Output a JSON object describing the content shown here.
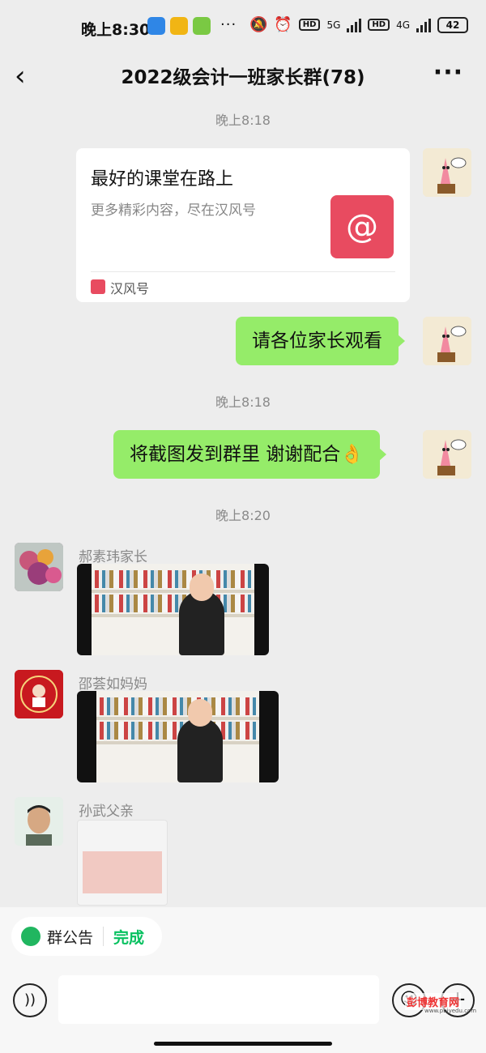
{
  "status_bar": {
    "time": "晚上8:30",
    "more_dots": "···",
    "net1": "5G",
    "net2": "4G",
    "hd": "HD",
    "battery": "42"
  },
  "header": {
    "back_icon": "‹",
    "title": "2022级会计一班家长群(78)",
    "more_icon": "···"
  },
  "messages": {
    "ts1": "晚上8:18",
    "card": {
      "title": "最好的课堂在路上",
      "subtitle": "更多精彩内容，尽在汉风号",
      "source": "汉风号",
      "logo_glyph": "@"
    },
    "bubble1": "请各位家长观看",
    "ts2": "晚上8:18",
    "bubble2": "将截图发到群里  谢谢配合👌",
    "ts3": "晚上8:20",
    "sender1": "郝素玮家长",
    "sender2": "邵荟如妈妈",
    "sender3": "孙武父亲"
  },
  "bottom": {
    "notice_label": "群公告",
    "done_label": "完成",
    "voice_icon": "))",
    "emoji_icon": "☺",
    "plus_icon": "+"
  },
  "watermark": {
    "text": "彭博教育网",
    "url": "www.pbjyedu.com"
  },
  "colors": {
    "bubble_green": "#95ec69",
    "wechat_green": "#07c160",
    "card_logo_red": "#e84b60",
    "background": "#ededed"
  }
}
